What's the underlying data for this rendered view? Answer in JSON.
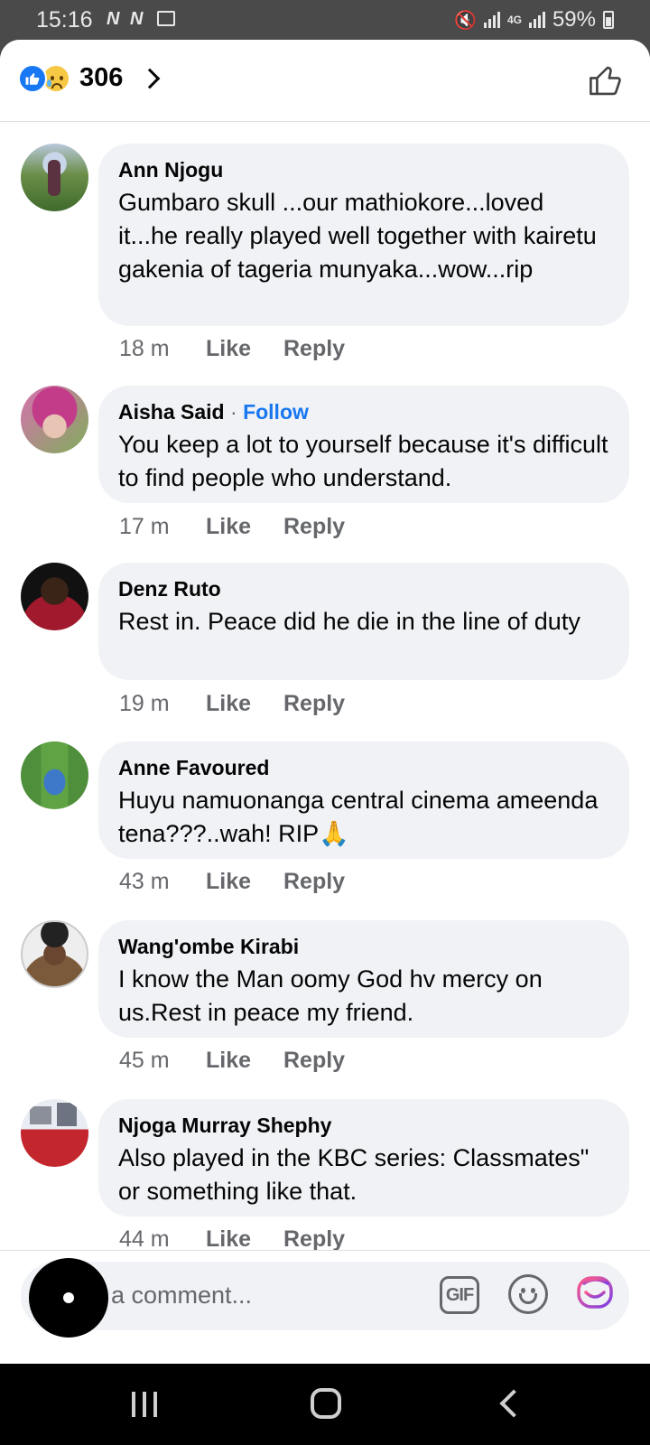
{
  "status_bar": {
    "time": "15:16",
    "left_icons": "N N",
    "network": "4G",
    "battery": "59%"
  },
  "header": {
    "reaction_count": "306",
    "reaction_icons": [
      "like-icon",
      "sad-icon"
    ]
  },
  "comments": [
    {
      "author": "Ann Njogu",
      "follow": "",
      "text": "Gumbaro skull ...our mathiokore...loved it...he really played well together with kairetu gakenia of tageria munyaka...wow...rip",
      "time": "18 m",
      "like": "Like",
      "reply": "Reply"
    },
    {
      "author": "Aisha Said",
      "follow": "Follow",
      "text": "You keep a lot to yourself because it's difficult to find people who understand.",
      "time": "17 m",
      "like": "Like",
      "reply": "Reply"
    },
    {
      "author": "Denz Ruto",
      "follow": "",
      "text": "Rest in. Peace did he die in the line of duty",
      "time": "19 m",
      "like": "Like",
      "reply": "Reply"
    },
    {
      "author": "Anne Favoured",
      "follow": "",
      "text": "Huyu namuonanga central cinema ameenda tena???..wah! RIP🙏",
      "time": "43 m",
      "like": "Like",
      "reply": "Reply"
    },
    {
      "author": "Wang'ombe Kirabi",
      "follow": "",
      "text": "I know the Man oomy God hv mercy on us.Rest in peace my friend.",
      "time": "45 m",
      "like": "Like",
      "reply": "Reply"
    },
    {
      "author": "Njoga Murray Shephy",
      "follow": "",
      "text": "Also played in the KBC series: Classmates\" or something like that.",
      "time": "44 m",
      "like": "Like",
      "reply": "Reply"
    }
  ],
  "composer": {
    "placeholder": "a comment...",
    "gif_label": "GIF"
  },
  "colors": {
    "accent": "#1877f2",
    "bubble": "#f0f2f5",
    "secondary_text": "#65676b"
  }
}
